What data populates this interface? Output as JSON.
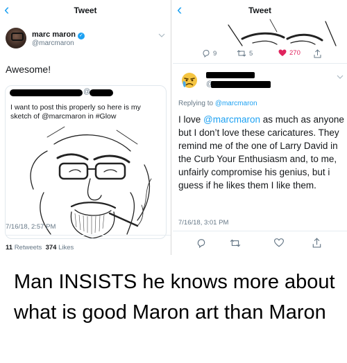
{
  "left_panel": {
    "nav_title": "Tweet",
    "back_glyph": "‹",
    "author": {
      "name": "marc maron",
      "handle": "@marcmaron",
      "verified_glyph": "✓"
    },
    "tweet_text": "Awesome!",
    "quoted_tweet": {
      "handle_prefix": "@",
      "text": "I want to post this properly so here is my sketch of @marcmaron in #Glow"
    },
    "timestamp": "7/16/18, 2:57 PM",
    "stats": {
      "retweets_count": "11",
      "retweets_label": "Retweets",
      "likes_count": "374",
      "likes_label": "Likes"
    }
  },
  "right_panel": {
    "nav_title": "Tweet",
    "back_glyph": "‹",
    "actions_top": {
      "replies": "9",
      "retweets": "5",
      "likes": "270"
    },
    "reply_author_handle_prefix": "@",
    "replying_to_label": "Replying to",
    "replying_to_handle": "@marcmaron",
    "reply_text_before": "I love ",
    "reply_mention": "@marcmaron",
    "reply_text_after": " as much as anyone but I don’t love these caricatures. They remind me of the one of Larry David in the Curb Your Enthusiasm and, to me, unfairly compromise his genius, but i guess if he likes them I like them.",
    "timestamp": "7/16/18, 3:01 PM"
  },
  "caption": "Man INSISTS he knows more about what is good Maron art than Maron",
  "colors": {
    "link": "#1da1f2",
    "secondary_text": "#657786",
    "like": "#e0245e"
  },
  "icons": [
    "back-chevron-icon",
    "verified-icon",
    "reply-icon",
    "retweet-icon",
    "like-icon",
    "share-icon",
    "chevron-down-icon"
  ]
}
